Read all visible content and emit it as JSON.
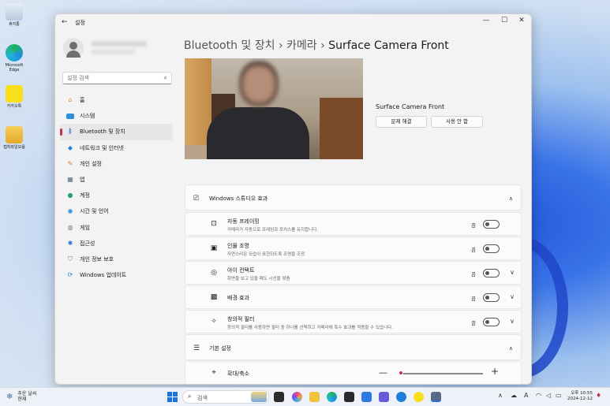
{
  "desktop": {
    "icons": [
      {
        "name": "recycle-bin",
        "label": "휴지통"
      },
      {
        "name": "microsoft-edge",
        "label": "Microsoft Edge"
      },
      {
        "name": "kakaotalk",
        "label": "카카오톡"
      },
      {
        "name": "folder",
        "label": "캡처파일모음"
      }
    ]
  },
  "window": {
    "title": "설정",
    "controls": {
      "minimize": "—",
      "maximize": "☐",
      "close": "✕"
    }
  },
  "sidebar": {
    "search_placeholder": "설정 검색",
    "items": [
      {
        "label": "홈",
        "icon": "home-icon",
        "color": "#e08a3c"
      },
      {
        "label": "시스템",
        "icon": "monitor-icon",
        "color": "#2f8fd8"
      },
      {
        "label": "Bluetooth 및 장치",
        "icon": "bluetooth-icon",
        "color": "#1f6fd6",
        "active": true
      },
      {
        "label": "네트워크 및 인터넷",
        "icon": "wifi-icon",
        "color": "#2f7fd8"
      },
      {
        "label": "개인 설정",
        "icon": "brush-icon",
        "color": "#d67a2f"
      },
      {
        "label": "앱",
        "icon": "apps-icon",
        "color": "#5a6a86"
      },
      {
        "label": "계정",
        "icon": "person-icon",
        "color": "#2aa06a"
      },
      {
        "label": "시간 및 언어",
        "icon": "globe-clock-icon",
        "color": "#2f8fd8"
      },
      {
        "label": "게임",
        "icon": "gamepad-icon",
        "color": "#6e7a8e"
      },
      {
        "label": "접근성",
        "icon": "accessibility-icon",
        "color": "#2f6fd8"
      },
      {
        "label": "개인 정보 보호",
        "icon": "shield-icon",
        "color": "#7a7a7a"
      },
      {
        "label": "Windows 업데이트",
        "icon": "update-icon",
        "color": "#1f7fd8"
      }
    ]
  },
  "main": {
    "breadcrumb": [
      {
        "label": "Bluetooth 및 장치"
      },
      {
        "label": "카메라"
      },
      {
        "label": "Surface Camera Front"
      }
    ],
    "breadcrumb_sep": "›",
    "device_name": "Surface Camera Front",
    "buttons": {
      "troubleshoot": "문제 해결",
      "disable": "사용 안 함"
    },
    "studio_effects": {
      "title": "Windows 스튜디오 효과",
      "rows": [
        {
          "title": "자동 프레이밍",
          "desc": "카메라가 자동으로 프레임과 포커스를 유지합니다.",
          "state": "끔",
          "icon": "frame-icon",
          "expandable": false
        },
        {
          "title": "인물 조명",
          "desc": "자연스러운 모습이 표현되도록 조명을 조정",
          "state": "끔",
          "icon": "portrait-light-icon",
          "expandable": false
        },
        {
          "title": "아이 컨택트",
          "desc": "화면을 보고 있을 때도 시선을 맞춤",
          "state": "끔",
          "icon": "eye-contact-icon",
          "expandable": true
        },
        {
          "title": "배경 효과",
          "desc": "",
          "state": "끔",
          "icon": "background-effect-icon",
          "expandable": true
        },
        {
          "title": "창의적 필터",
          "desc": "창의적 필터를 사용하면 필터 중 하나를 선택하고 카메라에 특수 효과를 적용할 수 있습니다.",
          "state": "끔",
          "icon": "creative-filter-icon",
          "expandable": true
        }
      ]
    },
    "basic_settings": {
      "title": "기본 설정",
      "zoom_label": "확대/축소",
      "zoom_value": 0.02
    }
  },
  "taskbar": {
    "weather": {
      "line1": "추운 날씨",
      "line2": "현재"
    },
    "search": "검색",
    "tray_lang": "A",
    "time": "오후 10:55",
    "date": "2024-12-12"
  },
  "colors": {
    "accent": "#c4314b",
    "windows_blue": "#1a73d8"
  }
}
